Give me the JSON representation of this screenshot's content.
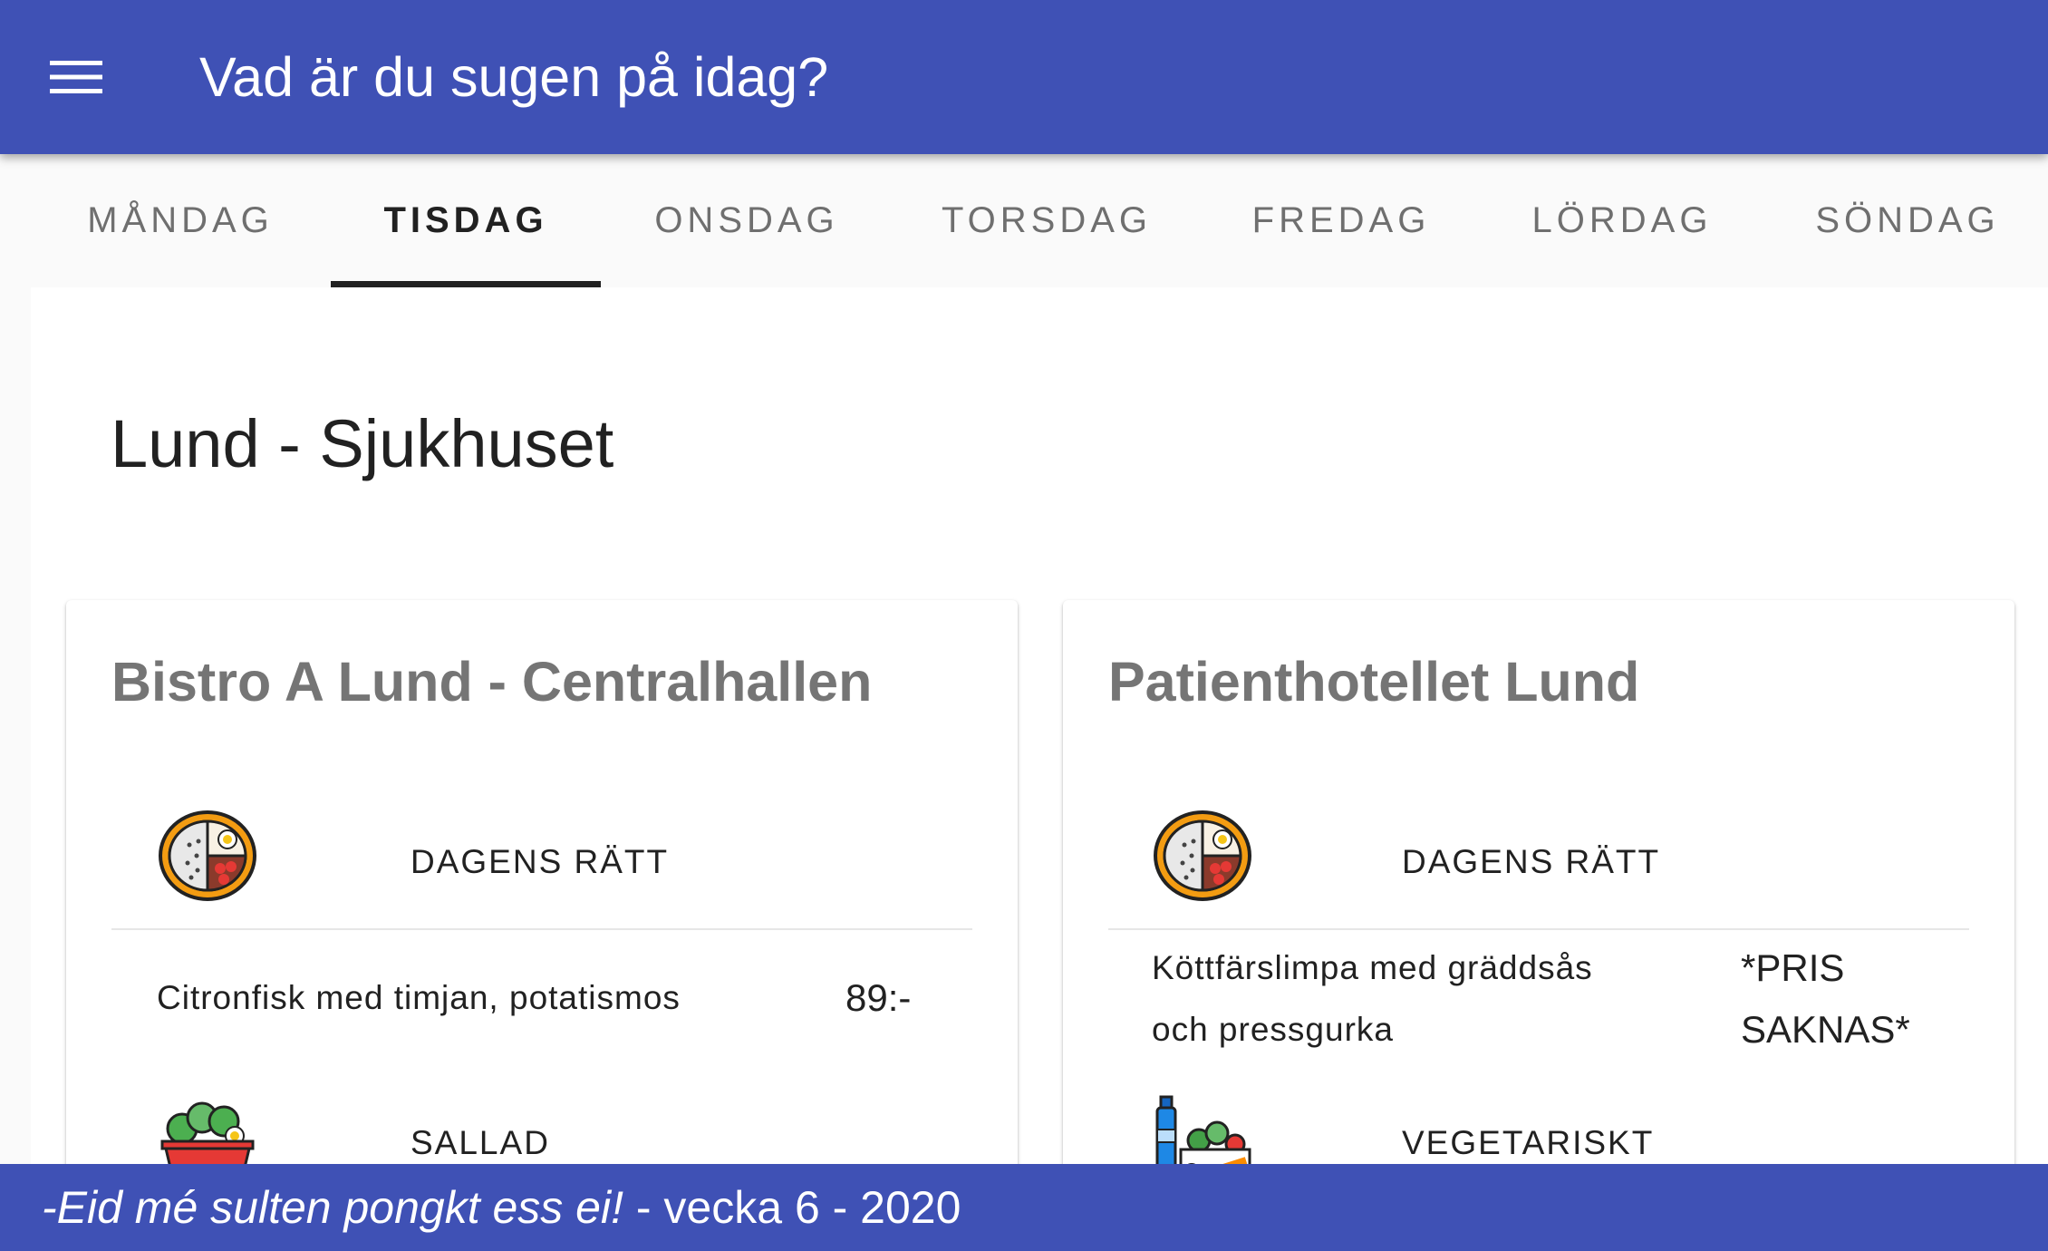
{
  "header": {
    "title": "Vad är du sugen på idag?",
    "menu_icon": "menu-icon",
    "color": "#3f51b5"
  },
  "tabs": [
    {
      "label": "MÅNDAG"
    },
    {
      "label": "TISDAG"
    },
    {
      "label": "ONSDAG"
    },
    {
      "label": "TORSDAG"
    },
    {
      "label": "FREDAG"
    },
    {
      "label": "LÖRDAG"
    },
    {
      "label": "SÖNDAG"
    }
  ],
  "active_tab": "TISDAG",
  "location": {
    "title": "Lund - Sjukhuset"
  },
  "restaurants": [
    {
      "name": "Bistro A Lund - Centralhallen",
      "sections": [
        {
          "category": "DAGENS RÄTT",
          "icon": "plate-meal-icon",
          "dish": "Citronfisk med timjan, potatismos",
          "price": "89:-"
        },
        {
          "category": "SALLAD",
          "icon": "salad-bowl-icon"
        }
      ]
    },
    {
      "name": "Patienthotellet Lund",
      "sections": [
        {
          "category": "DAGENS RÄTT",
          "icon": "plate-meal-icon",
          "dish_line1": "Köttfärslimpa med gräddsås",
          "dish_line2": "och pressgurka",
          "price_line1": "*PRIS",
          "price_line2": "SAKNAS*"
        },
        {
          "category": "VEGETARISKT",
          "icon": "vegetables-icon"
        }
      ]
    }
  ],
  "footer": {
    "slogan": "-Eid mé sulten pongkt ess ei!",
    "week_text": " - vecka 6 - 2020"
  }
}
